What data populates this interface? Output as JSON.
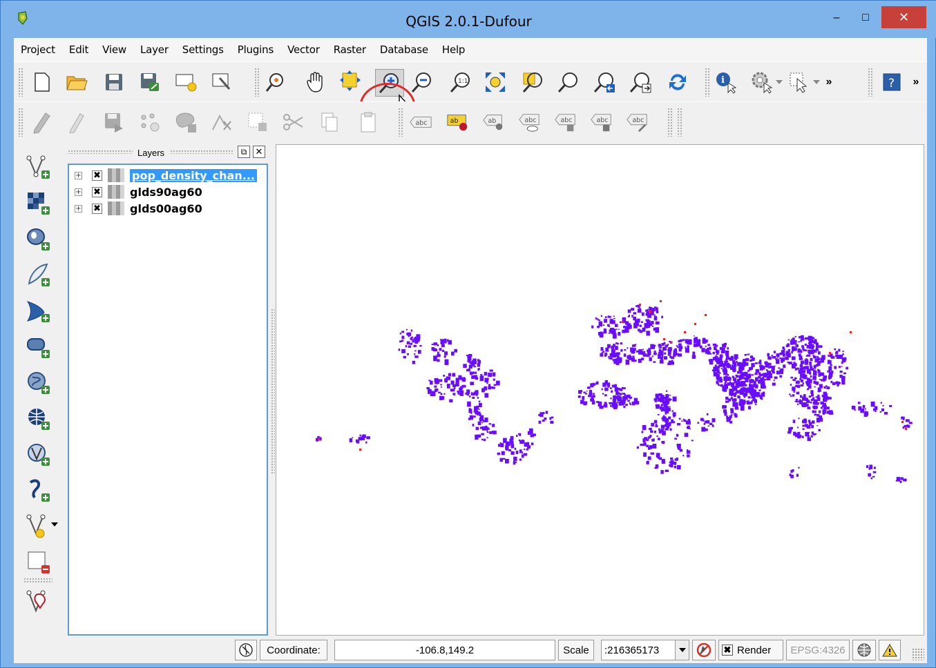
{
  "window": {
    "title": "QGIS 2.0.1-Dufour",
    "minimize": "–",
    "maximize": "□",
    "close": "✕"
  },
  "menu": [
    "Project",
    "Edit",
    "View",
    "Layer",
    "Settings",
    "Plugins",
    "Vector",
    "Raster",
    "Database",
    "Help"
  ],
  "toolbar_overflow": "»",
  "layers_panel": {
    "title": "Layers",
    "layers": [
      {
        "name": "pop_density_chan...",
        "checked": "✖",
        "selected": true
      },
      {
        "name": "glds90ag60",
        "checked": "✖",
        "selected": false
      },
      {
        "name": "glds00ag60",
        "checked": "✖",
        "selected": false
      }
    ]
  },
  "map": {
    "primary_color": "#6a0dff",
    "highlight_color": "#ff1a1a"
  },
  "statusbar": {
    "coordinate_label": "Coordinate:",
    "coordinate_value": "-106.8,149.2",
    "scale_label": "Scale",
    "scale_value": ":216365173",
    "render_label": "Render",
    "render_checked": "✖",
    "crs": "EPSG:4326"
  },
  "colors": {
    "titlebar": "#7eb4ea",
    "selection": "#3399ff",
    "circle": "#e02a2a"
  }
}
